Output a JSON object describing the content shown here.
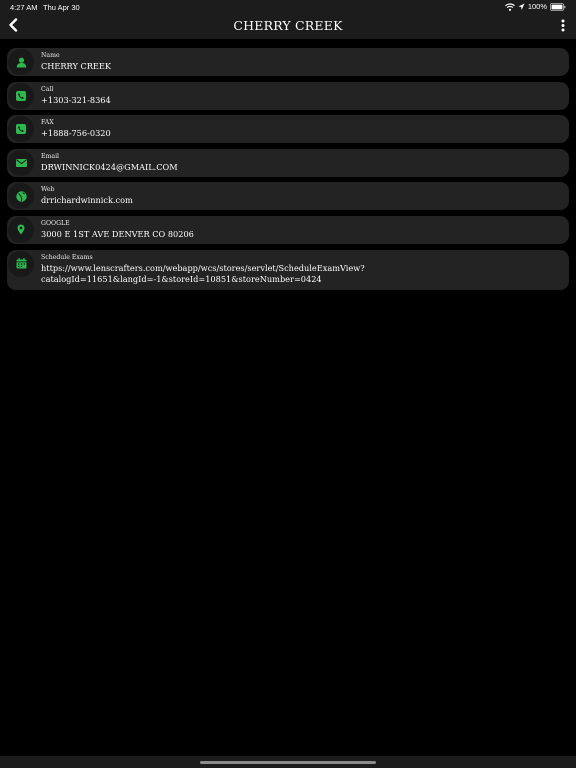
{
  "status_bar": {
    "time": "4:27 AM",
    "date": "Thu Apr 30",
    "battery": "100%",
    "icons": [
      "wifi-icon",
      "location-icon",
      "battery-icon"
    ]
  },
  "nav": {
    "title": "CHERRY CREEK",
    "back_icon": "chevron-left-icon",
    "more_icon": "more-vertical-icon"
  },
  "colors": {
    "accent": "#2db84d",
    "row_background": "#232323",
    "bar_background": "#1c1c1c",
    "page_background": "#000000"
  },
  "rows": [
    {
      "label": "Name",
      "value": "CHERRY CREEK",
      "icon": "person-icon"
    },
    {
      "label": "Call",
      "value": "+1303-321-8364",
      "icon": "phone-icon"
    },
    {
      "label": "FAX",
      "value": "+1888-756-0320",
      "icon": "phone-icon"
    },
    {
      "label": "Email",
      "value": "DRWINNICK0424@GMAIL.COM",
      "icon": "mail-icon"
    },
    {
      "label": "Web",
      "value": "drrichardwinnick.com",
      "icon": "globe-icon"
    },
    {
      "label": "GOOGLE",
      "value": "3000 E 1ST AVE DENVER CO 80206",
      "icon": "map-pin-icon"
    },
    {
      "label": "Schedule Exams",
      "value_line1": "https://www.lenscrafters.com/webapp/wcs/stores/servlet/ScheduleExamView?",
      "value_line2": "catalogId=11651&langId=-1&storeId=10851&storeNumber=0424",
      "icon": "calendar-icon"
    }
  ]
}
